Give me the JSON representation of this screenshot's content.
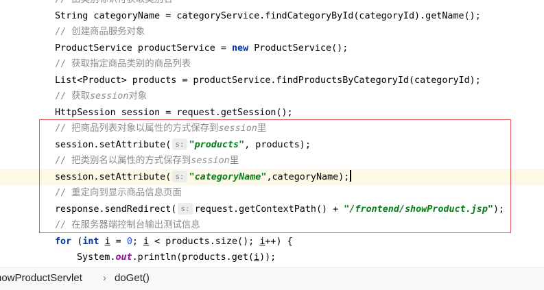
{
  "editor": {
    "lines": [
      {
        "type": "comment",
        "text": "// 由类别标识符获取类别名"
      },
      {
        "type": "code",
        "parts": [
          {
            "t": "String categoryName = categoryService.findCategoryById(categoryId).getName();"
          }
        ]
      },
      {
        "type": "comment",
        "text": "// 创建商品服务对象"
      },
      {
        "type": "code",
        "parts": [
          {
            "t": "ProductService productService = "
          },
          {
            "t": "new",
            "k": "kw"
          },
          {
            "t": " ProductService();"
          }
        ]
      },
      {
        "type": "comment",
        "text": "// 获取指定商品类别的商品列表"
      },
      {
        "type": "code",
        "parts": [
          {
            "t": "List<Product> products = productService.findProductsByCategoryId(categoryId);"
          }
        ]
      },
      {
        "type": "comment",
        "parts": [
          {
            "t": "// 获取"
          },
          {
            "t": "session",
            "k": "cit"
          },
          {
            "t": "对象"
          }
        ]
      },
      {
        "type": "code",
        "parts": [
          {
            "t": "HttpSession session = request.getSession();"
          }
        ]
      },
      {
        "type": "comment",
        "parts": [
          {
            "t": "// 把商品列表对象以属性的方式保存到"
          },
          {
            "t": "session",
            "k": "cit"
          },
          {
            "t": "里"
          }
        ]
      },
      {
        "type": "code",
        "parts": [
          {
            "t": "session.setAttribute("
          },
          {
            "t": "s:",
            "k": "hint"
          },
          {
            "t": "\"products\"",
            "k": "str"
          },
          {
            "t": ", products);"
          }
        ]
      },
      {
        "type": "comment",
        "parts": [
          {
            "t": "// 把类别名以属性的方式保存到"
          },
          {
            "t": "session",
            "k": "cit"
          },
          {
            "t": "里"
          }
        ]
      },
      {
        "type": "code",
        "highlight": true,
        "parts": [
          {
            "t": "session.setAttribute("
          },
          {
            "t": "s:",
            "k": "hint"
          },
          {
            "t": "\"categoryName\"",
            "k": "str"
          },
          {
            "t": ",categoryName);"
          },
          {
            "t": "",
            "k": "caret"
          }
        ]
      },
      {
        "type": "comment",
        "text": "// 重定向到显示商品信息页面"
      },
      {
        "type": "code",
        "parts": [
          {
            "t": "response.sendRedirect("
          },
          {
            "t": "s:",
            "k": "hint"
          },
          {
            "t": "request.getContextPath() + "
          },
          {
            "t": "\"/frontend/showProduct.jsp\"",
            "k": "str"
          },
          {
            "t": ");"
          }
        ]
      },
      {
        "type": "comment",
        "text": "// 在服务器端控制台输出测试信息"
      },
      {
        "type": "code",
        "parts": [
          {
            "t": "for",
            "k": "kw"
          },
          {
            "t": " ("
          },
          {
            "t": "int",
            "k": "kw"
          },
          {
            "t": " "
          },
          {
            "t": "i",
            "k": "ul"
          },
          {
            "t": " = "
          },
          {
            "t": "0",
            "k": "num"
          },
          {
            "t": "; "
          },
          {
            "t": "i",
            "k": "ul"
          },
          {
            "t": " < products.size(); "
          },
          {
            "t": "i",
            "k": "ul"
          },
          {
            "t": "++) {"
          }
        ]
      },
      {
        "type": "code",
        "indent": true,
        "parts": [
          {
            "t": "System."
          },
          {
            "t": "out",
            "k": "ital"
          },
          {
            "t": ".println(products.get("
          },
          {
            "t": "i",
            "k": "ul"
          },
          {
            "t": "));"
          }
        ]
      }
    ]
  },
  "breadcrumb": {
    "class_name": "howProductServlet",
    "separator": "›",
    "method": "doGet()"
  },
  "colors": {
    "keyword": "#0033b3",
    "string": "#067d17",
    "comment": "#8c8c8c",
    "highlight_box": "#e8585a",
    "current_line": "#fcfae6"
  }
}
